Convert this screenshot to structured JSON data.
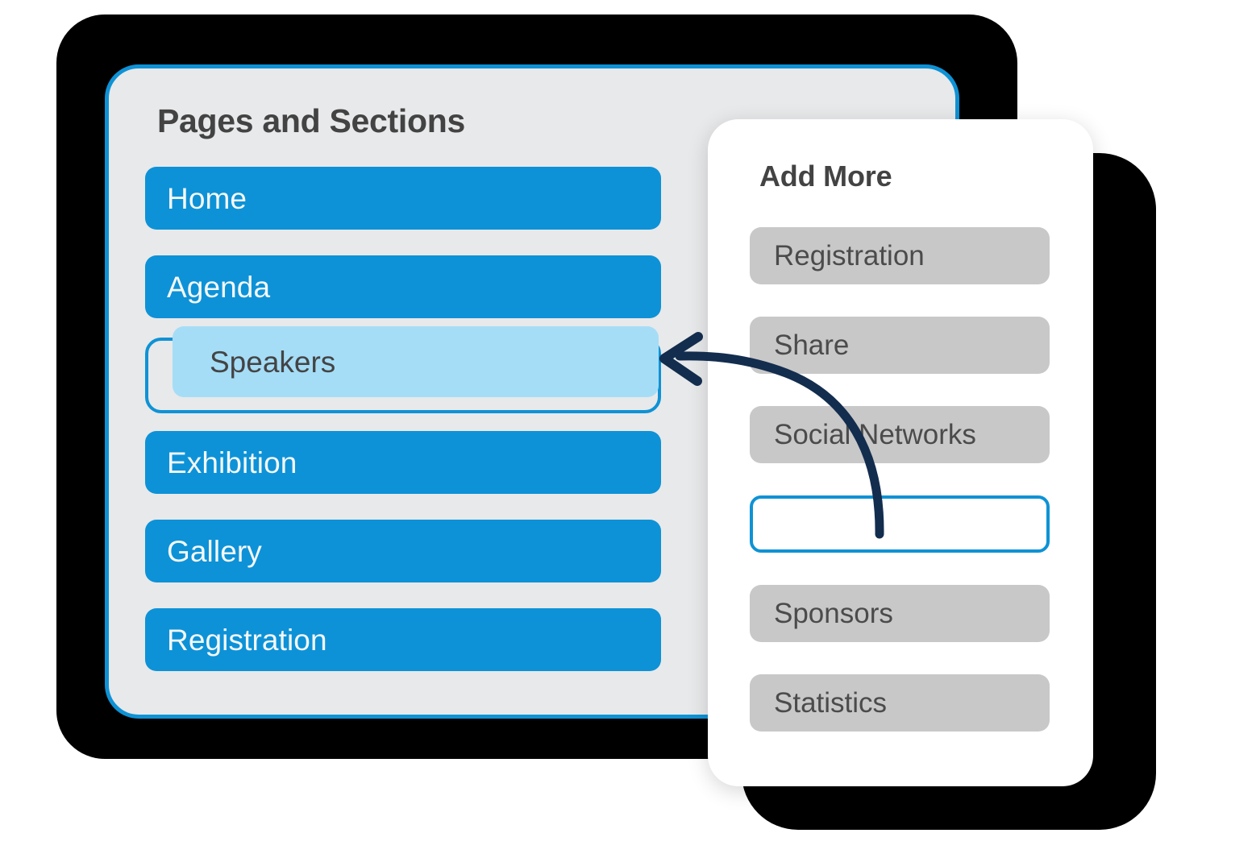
{
  "main_panel": {
    "title": "Pages and Sections",
    "accent_color": "#0f92d5",
    "background_color": "#e8e9ea",
    "button_color": "#0d92d7",
    "items": [
      {
        "label": "Home",
        "state": "active"
      },
      {
        "label": "Agenda",
        "state": "active"
      },
      {
        "label": "Speakers",
        "state": "dragging"
      },
      {
        "label": "Exhibition",
        "state": "active"
      },
      {
        "label": "Gallery",
        "state": "active"
      },
      {
        "label": "Registration",
        "state": "active"
      }
    ]
  },
  "add_more_panel": {
    "title": "Add More",
    "chip_color": "#c8c8c8",
    "items": [
      {
        "label": "Registration",
        "state": "available"
      },
      {
        "label": "Share",
        "state": "available"
      },
      {
        "label": "Social Networks",
        "state": "available"
      },
      {
        "label": "",
        "state": "empty-source-slot"
      },
      {
        "label": "Sponsors",
        "state": "available"
      },
      {
        "label": "Statistics",
        "state": "available"
      }
    ]
  },
  "annotation": {
    "arrow_color": "#132d4e",
    "arrow_meaning": "drag-from-add-more-to-pages-and-sections"
  }
}
